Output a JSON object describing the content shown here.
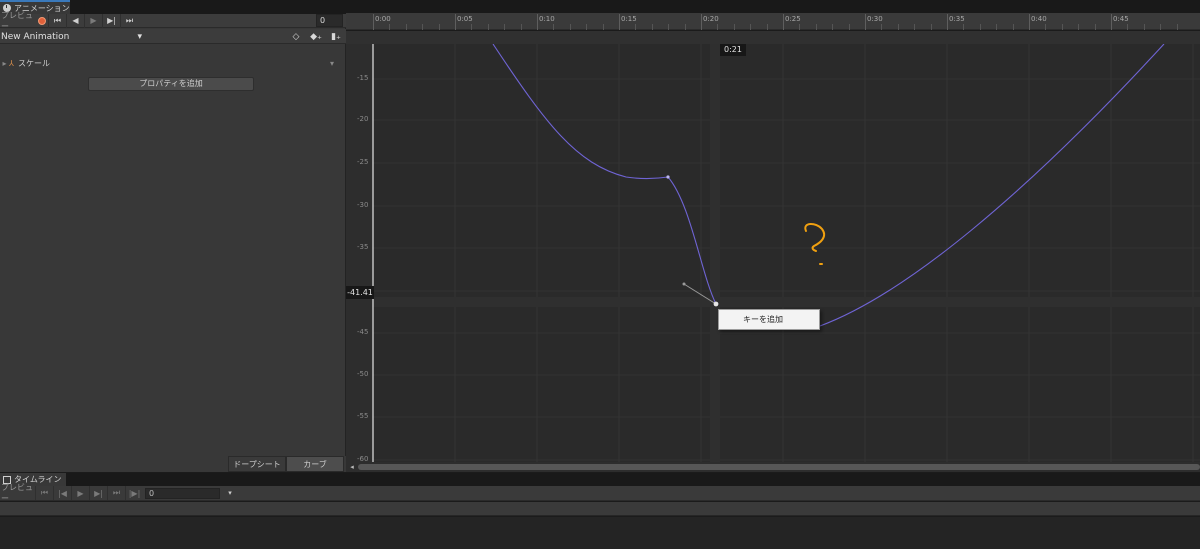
{
  "animation_window": {
    "tab_title": "アニメーション",
    "toolbar": {
      "preview_label": "プレビュー",
      "buttons": [
        "⏮",
        "◀",
        "▶",
        "▶|",
        "⏭"
      ],
      "frame_value": "0"
    },
    "clip": {
      "name": "New Animation",
      "dropdown_icon": "▾",
      "keyframe_btn": "◇",
      "add_key_btn": "◆₊",
      "add_event_btn": "▮₊"
    },
    "properties": [
      {
        "name": "スケール",
        "menu_icon": "▾"
      }
    ],
    "add_property_label": "プロパティを追加",
    "bottom_tabs": {
      "dopesheet": "ドープシート",
      "curves": "カーブ"
    },
    "ruler_labels": [
      "0:00",
      "0:05",
      "0:10",
      "0:15",
      "0:20",
      "0:25",
      "0:30",
      "0:35",
      "0:40",
      "0:45"
    ],
    "value_labels": [
      "-15",
      "-20",
      "-25",
      "-30",
      "-35",
      "-40",
      "-45",
      "-50",
      "-55",
      "-60"
    ],
    "current_time_tag": "0:21",
    "current_value_tag": "-41.41",
    "context_menu_item": "キーを追加",
    "curve_color": "#6f64d4",
    "annotation_color": "#f0a010"
  },
  "timeline_window": {
    "tab_title": "タイムライン",
    "preview_label": "プレビュー",
    "buttons": [
      "⏮",
      "|◀",
      "▶",
      "▶|",
      "⏭",
      "|▶|"
    ],
    "frame_value": "0",
    "dropdown_icon": "▾"
  }
}
